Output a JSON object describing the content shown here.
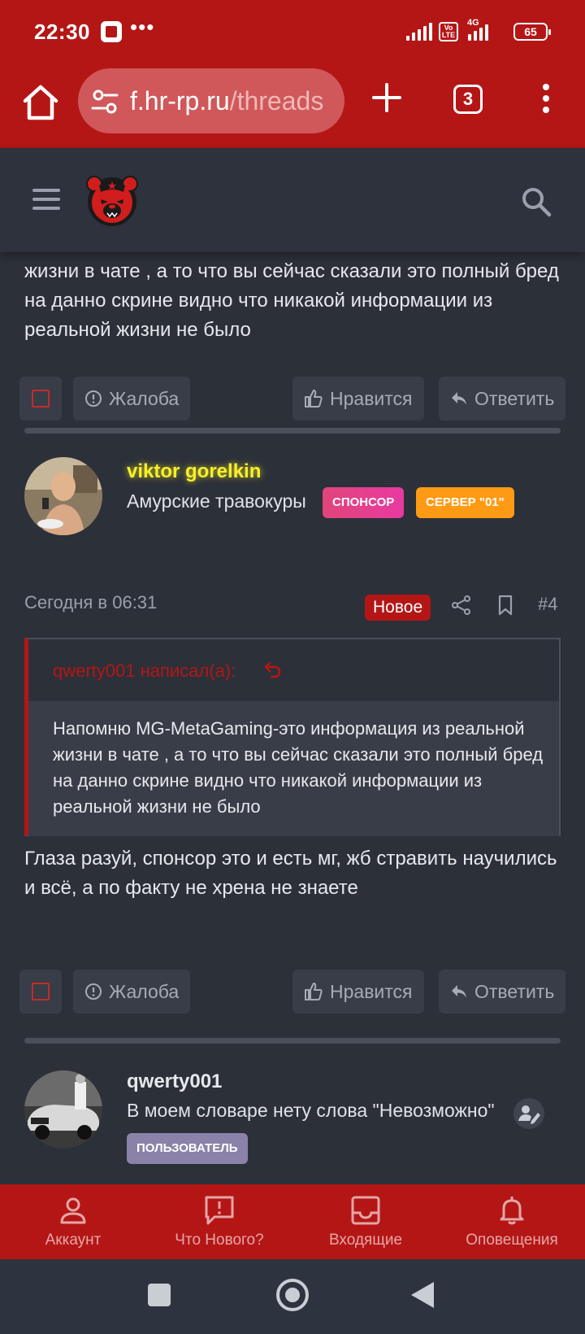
{
  "status_bar": {
    "time": "22:30",
    "dots": "•••",
    "volte": "Vo LTE",
    "network": "4G",
    "battery": "65"
  },
  "browser": {
    "url_host": "f.hr-rp.ru",
    "url_path": "/threads",
    "tab_count": "3"
  },
  "site": {
    "logo_icon": "red-bear-logo-icon",
    "accent_color": "#b41616"
  },
  "posts": {
    "truncated_text": "Напомню MG-MetaGaming-это информация из реальной жизни в чате , а то что вы сейчас сказали это полный бред на данно скрине видно что никакой информации из реальной жизни не было",
    "actions": {
      "report_label": "Жалоба",
      "like_label": "Нравится",
      "reply_label": "Ответить"
    },
    "viktor": {
      "username": "viktor gorelkin",
      "user_title": "Амурские травокуры",
      "badge_sponsor": "СПОНСОР",
      "badge_server": "СЕРВЕР \"01\""
    },
    "post4": {
      "date": "Сегодня в 06:31",
      "new_label": "Новое",
      "number": "#4",
      "quote_author": "qwerty001 написал(а):",
      "quote_text": "Напомню MG-MetaGaming-это информация из реальной жизни в чате , а то что вы сейчас сказали это полный бред на данно скрине видно что никакой информации из реальной жизни не было",
      "reply_text": "Глаза разуй, спонсор это и есть мг, жб стравить научились и всё, а по факту не хрена не знаете"
    },
    "qwerty": {
      "username": "qwerty001",
      "user_title": "В моем словаре нету слова \"Невозможно\"",
      "badge_user": "ПОЛЬЗОВАТЕЛЬ"
    }
  },
  "bottom_nav": {
    "account": "Аккаунт",
    "whats_new": "Что Нового?",
    "inbox": "Входящие",
    "alerts": "Оповещения"
  }
}
